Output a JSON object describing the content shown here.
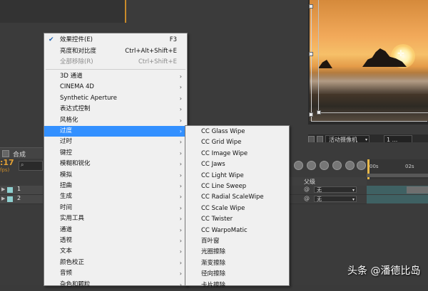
{
  "context_menu": {
    "items": [
      {
        "label": "效果控件(E)",
        "shortcut": "F3",
        "checked": true,
        "disabled": false
      },
      {
        "label": "亮度和对比度",
        "shortcut": "Ctrl+Alt+Shift+E",
        "disabled": false
      },
      {
        "label": "全部移除(R)",
        "shortcut": "Ctrl+Shift+E",
        "disabled": true
      }
    ],
    "categories": [
      {
        "label": "3D 通道"
      },
      {
        "label": "CINEMA 4D"
      },
      {
        "label": "Synthetic Aperture"
      },
      {
        "label": "表达式控制"
      },
      {
        "label": "风格化"
      },
      {
        "label": "过度",
        "selected": true
      },
      {
        "label": "过时"
      },
      {
        "label": "键控"
      },
      {
        "label": "模糊和锐化"
      },
      {
        "label": "模拟"
      },
      {
        "label": "扭曲"
      },
      {
        "label": "生成"
      },
      {
        "label": "时间"
      },
      {
        "label": "实用工具"
      },
      {
        "label": "通道"
      },
      {
        "label": "透视"
      },
      {
        "label": "文本"
      },
      {
        "label": "颜色校正"
      },
      {
        "label": "音频"
      },
      {
        "label": "杂色和颗粒"
      }
    ],
    "submenu_arrow": "›"
  },
  "submenu": {
    "items": [
      "CC Glass Wipe",
      "CC Grid Wipe",
      "CC Image Wipe",
      "CC Jaws",
      "CC Light Wipe",
      "CC Line Sweep",
      "CC Radial ScaleWipe",
      "CC Scale Wipe",
      "CC Twister",
      "CC WarpoMatic",
      "百叶窗",
      "光圈擦除",
      "渐变擦除",
      "径向擦除",
      "卡片擦除"
    ]
  },
  "timeline": {
    "tab_label": "合成",
    "current_time": ":17",
    "fps_label": "fps)",
    "layers": [
      {
        "number": "1",
        "parent": "无"
      },
      {
        "number": "2",
        "parent": "无"
      }
    ],
    "parent_header": "父级",
    "ruler_ticks": [
      "00s",
      "02s"
    ]
  },
  "viewer": {
    "camera_label": "活动摄像机",
    "views_label": "1 ..."
  },
  "watermark": "头条 @潘德比岛",
  "colors": {
    "menu_selected": "#3390ff",
    "time_orange": "#e2a034"
  }
}
